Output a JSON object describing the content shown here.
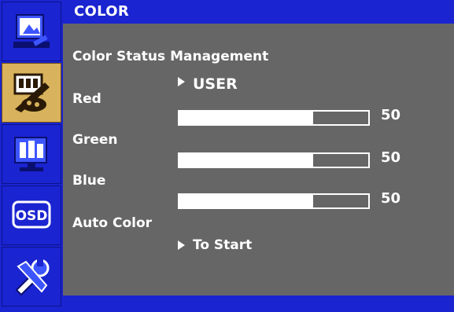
{
  "header": {
    "title": "COLOR"
  },
  "sidebar": {
    "tabs": [
      {
        "name": "picture",
        "icon": "picture-icon",
        "active": false
      },
      {
        "name": "color",
        "icon": "color-palette-icon",
        "active": true
      },
      {
        "name": "monitor",
        "icon": "monitor-icon",
        "active": false
      },
      {
        "name": "osd",
        "icon": "osd-icon",
        "icon_text": "OSD",
        "active": false
      },
      {
        "name": "tools",
        "icon": "tools-icon",
        "active": false
      }
    ]
  },
  "menu": {
    "color_status": {
      "label": "Color Status Management",
      "value": "USER"
    },
    "red": {
      "label": "Red",
      "value": "50",
      "level": 0.71
    },
    "green": {
      "label": "Green",
      "value": "50",
      "level": 0.71
    },
    "blue": {
      "label": "Blue",
      "value": "50",
      "level": 0.71
    },
    "auto_color": {
      "label": "Auto Color",
      "action": "To Start"
    }
  },
  "colors": {
    "frame": "#1a24d0",
    "panel": "#666666",
    "active_tab": "#d8b25c",
    "text": "#ffffff"
  }
}
